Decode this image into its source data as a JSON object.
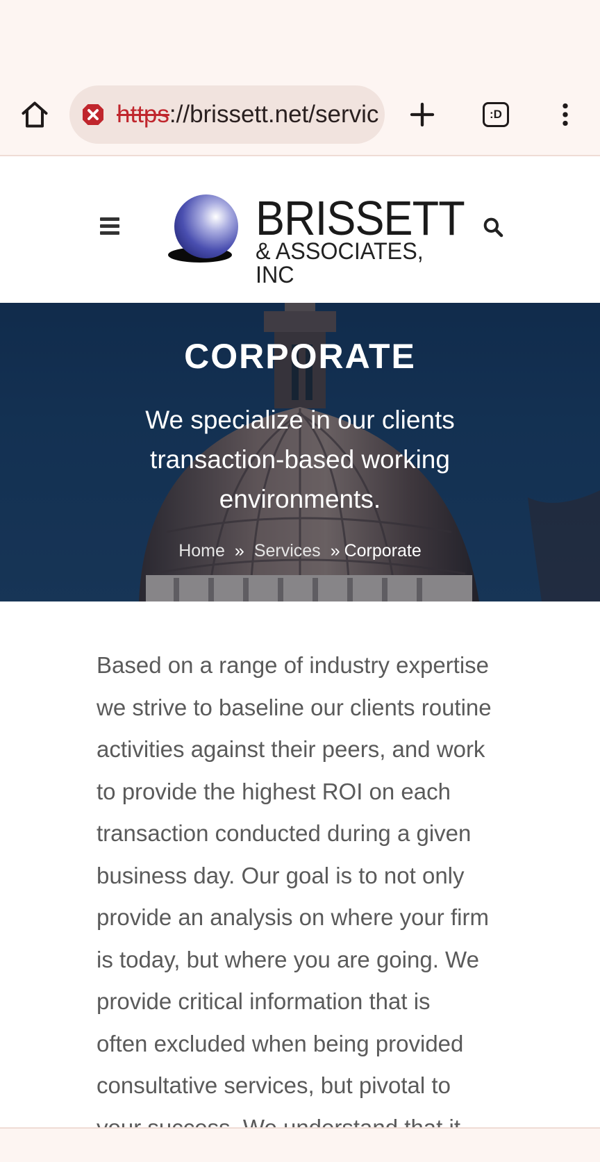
{
  "browser": {
    "url_scheme": "https",
    "url_rest": "://brissett.net/servic",
    "tab_count_label": ":D"
  },
  "site": {
    "logo_word": "BRISSETT",
    "logo_sub": "& ASSOCIATES, INC"
  },
  "hero": {
    "title": "CORPORATE",
    "subtitle": "We specialize in our clients transaction-based working environments.",
    "breadcrumb": {
      "home": "Home",
      "sep1": "»",
      "services": "Services",
      "sep2": "»",
      "current": "Corporate"
    }
  },
  "content": {
    "paragraph": "Based on a range of industry expertise\nwe strive to baseline our clients routine\nactivities against their peers, and work\nto provide the highest ROI on each\ntransaction conducted during a given\nbusiness day.    Our goal is to not only\nprovide an analysis on where your firm\nis today, but where you are going.   We\nprovide critical information that is\noften excluded when being provided\nconsultative services, but pivotal to\nyour success.     We understand that it"
  },
  "colors": {
    "chrome_bg": "#fdf5f2",
    "url_bar_bg": "#f1e3de",
    "insecure_red": "#c0262d",
    "hero_blue": "#183c60",
    "logo_sphere": "#4a4fb0"
  }
}
